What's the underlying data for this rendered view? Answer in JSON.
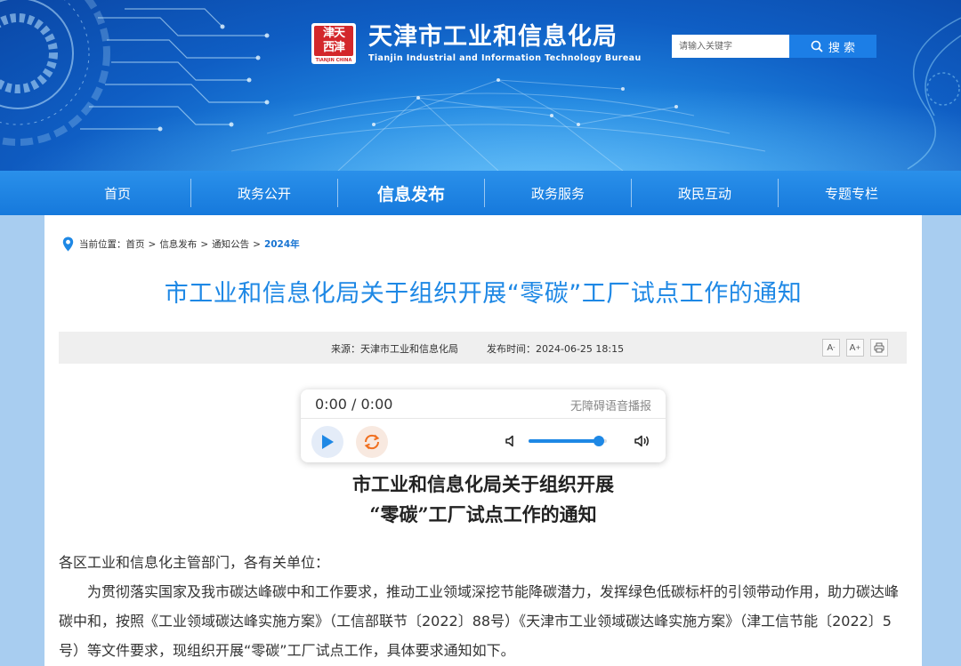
{
  "header": {
    "site_title": "天津市工业和信息化局",
    "site_subtitle": "Tianjin Industrial and Information Technology Bureau",
    "logo_text": "津天\n西津",
    "logo_caption": "TIANJIN CHINA",
    "search_placeholder": "请输入关键字",
    "search_button": "搜 索"
  },
  "nav": {
    "items": [
      {
        "label": "首页"
      },
      {
        "label": "政务公开"
      },
      {
        "label": "信息发布"
      },
      {
        "label": "政务服务"
      },
      {
        "label": "政民互动"
      },
      {
        "label": "专题专栏"
      }
    ],
    "active_index": 2
  },
  "breadcrumb": {
    "prefix": "当前位置：",
    "items": [
      "首页",
      "信息发布",
      "通知公告"
    ],
    "current": "2024年",
    "separator": ">"
  },
  "article": {
    "title": "市工业和信息化局关于组织开展“零碳”工厂试点工作的通知",
    "source_label": "来源：天津市工业和信息化局",
    "time_label": "发布时间：2024-06-25 18:15",
    "tools": {
      "font_decrease": "A⁻",
      "font_increase": "A⁺",
      "print": "print-icon"
    },
    "doc_title_line1": "市工业和信息化局关于组织开展",
    "doc_title_line2": "“零碳”工厂试点工作的通知",
    "salutation": "各区工业和信息化主管部门，各有关单位：",
    "paragraph": "为贯彻落实国家及我市碳达峰碳中和工作要求，推动工业领域深挖节能降碳潜力，发挥绿色低碳标杆的引领带动作用，助力碳达峰碳中和，按照《工业领域碳达峰实施方案》（工信部联节〔2022〕88号）《天津市工业领域碳达峰实施方案》（津工信节能〔2022〕5号）等文件要求，现组织开展“零碳”工厂试点工作，具体要求通知如下。"
  },
  "player": {
    "time": "0:00 / 0:00",
    "label": "无障碍语音播报",
    "volume": 0.9
  },
  "colors": {
    "accent": "#1e88e5",
    "nav_bg": "#1a7fe0",
    "page_bg": "#a8cdf0"
  }
}
